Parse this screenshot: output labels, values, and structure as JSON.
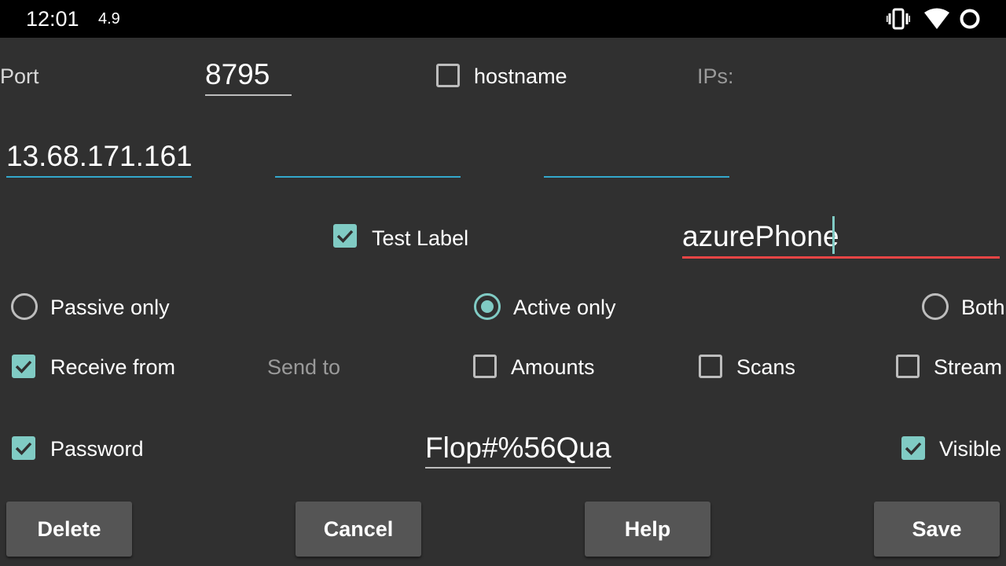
{
  "status_bar": {
    "time": "12:01",
    "extra": "4.9"
  },
  "port": {
    "label": "Port",
    "value": "8795"
  },
  "hostname": {
    "label": "hostname",
    "checked": false
  },
  "ips": {
    "label": "IPs:",
    "values": [
      "13.68.171.161",
      "",
      ""
    ]
  },
  "test_label": {
    "label": "Test Label",
    "checked": true,
    "value": "azurePhone"
  },
  "mode": {
    "options": [
      "Passive only",
      "Active only",
      "Both"
    ],
    "selected": "Active only"
  },
  "receive_from": {
    "label": "Receive from",
    "checked": true
  },
  "send_to": {
    "label": "Send to",
    "options": [
      {
        "label": "Amounts",
        "checked": false
      },
      {
        "label": "Scans",
        "checked": false
      },
      {
        "label": "Stream",
        "checked": false
      }
    ]
  },
  "password": {
    "label": "Password",
    "checked": true,
    "value": "Flop#%56Qua"
  },
  "visible": {
    "label": "Visible",
    "checked": true
  },
  "buttons": {
    "delete": "Delete",
    "cancel": "Cancel",
    "help": "Help",
    "save": "Save"
  },
  "colors": {
    "accent": "#80cbc4",
    "underline_active": "#33a8cc",
    "error": "#e84545",
    "background": "#303030"
  }
}
